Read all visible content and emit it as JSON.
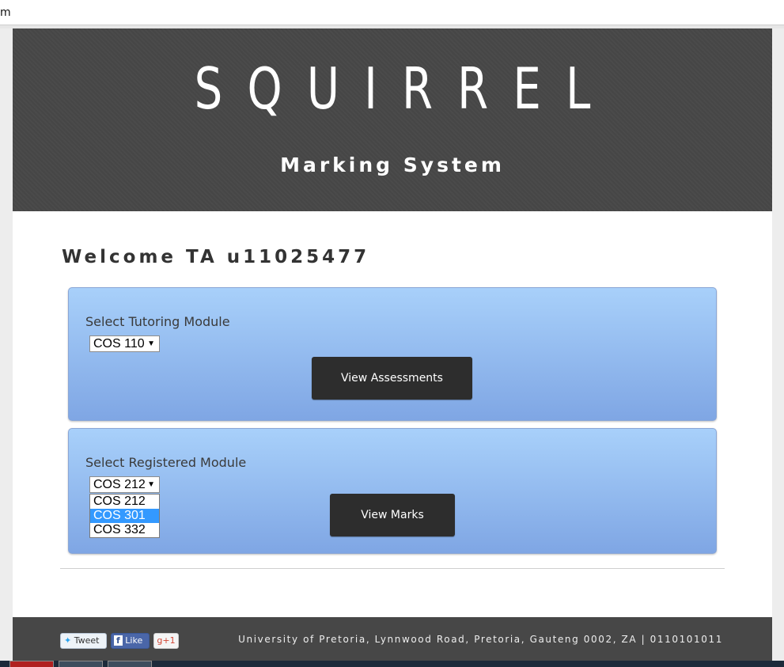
{
  "browser": {
    "address_fragment": "m"
  },
  "header": {
    "logo": "SQUIRREL",
    "tagline": "Marking System"
  },
  "main": {
    "welcome": "Welcome TA u11025477",
    "tutoring_panel": {
      "label": "Select Tutoring Module",
      "selected": "COS 110",
      "button": "View Assessments"
    },
    "registered_panel": {
      "label": "Select Registered Module",
      "selected": "COS 212",
      "options": [
        "COS 212",
        "COS 301",
        "COS 332"
      ],
      "highlighted_option": "COS 301",
      "button": "View Marks"
    }
  },
  "footer": {
    "tweet_label": "Tweet",
    "like_label": "Like",
    "gplus_label": "g+1",
    "info": "University of Pretoria, Lynnwood Road, Pretoria, Gauteng 0002, ZA | 0110101011"
  },
  "colors": {
    "header_bg": "#474747",
    "panel_top": "#a8d0fa",
    "panel_bottom": "#7fa6e4",
    "button_bg": "#2d2d2d",
    "highlight": "#3399ff"
  }
}
